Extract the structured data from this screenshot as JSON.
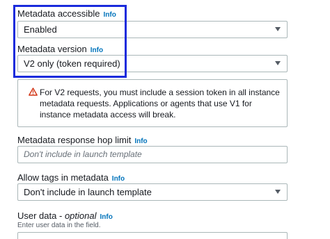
{
  "metadata_accessible": {
    "label": "Metadata accessible",
    "info": "Info",
    "value": "Enabled"
  },
  "metadata_version": {
    "label": "Metadata version",
    "info": "Info",
    "value": "V2 only (token required)"
  },
  "warning": {
    "icon": "warning-triangle-icon",
    "color": "#d13212",
    "text": "For V2 requests, you must include a session token in all instance metadata requests. Applications or agents that use V1 for instance metadata access will break."
  },
  "hop_limit": {
    "label": "Metadata response hop limit",
    "info": "Info",
    "placeholder": "Don't include in launch template"
  },
  "allow_tags": {
    "label": "Allow tags in metadata",
    "info": "Info",
    "value": "Don't include in launch template"
  },
  "user_data": {
    "label": "User data",
    "label_separator": " - ",
    "label_optional": "optional",
    "info": "Info",
    "hint": "Enter user data in the field."
  },
  "colors": {
    "highlight_border": "#1a2bdc",
    "link": "#0073bb",
    "warning": "#d13212"
  }
}
